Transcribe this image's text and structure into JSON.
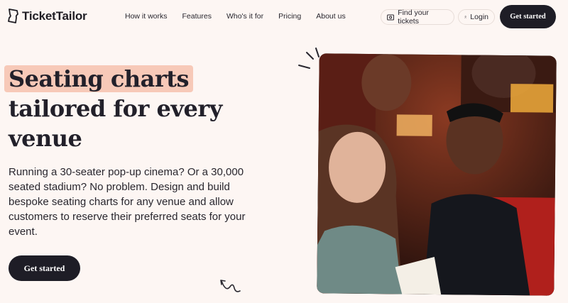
{
  "brand": {
    "name": "TicketTailor"
  },
  "nav": {
    "items": [
      {
        "label": "How it works"
      },
      {
        "label": "Features"
      },
      {
        "label": "Who's it for"
      },
      {
        "label": "Pricing"
      },
      {
        "label": "About us"
      }
    ]
  },
  "header_actions": {
    "find_tickets": "Find your tickets",
    "login": "Login",
    "get_started": "Get started"
  },
  "hero": {
    "headline_highlight": "Seating charts",
    "headline_line2": "tailored for every",
    "headline_line3": "venue",
    "description": "Running a 30-seater pop-up cinema? Or a 30,000 seated stadium? No problem. Design and build bespoke seating charts for any venue and allow customers to reserve their preferred seats for your event.",
    "cta": "Get started"
  },
  "icons": {
    "find_tickets": "ticket-icon",
    "login": "user-icon"
  },
  "colors": {
    "background": "#fdf6f3",
    "dark_button": "#1e1d26",
    "highlight": "#f7c9b8"
  }
}
